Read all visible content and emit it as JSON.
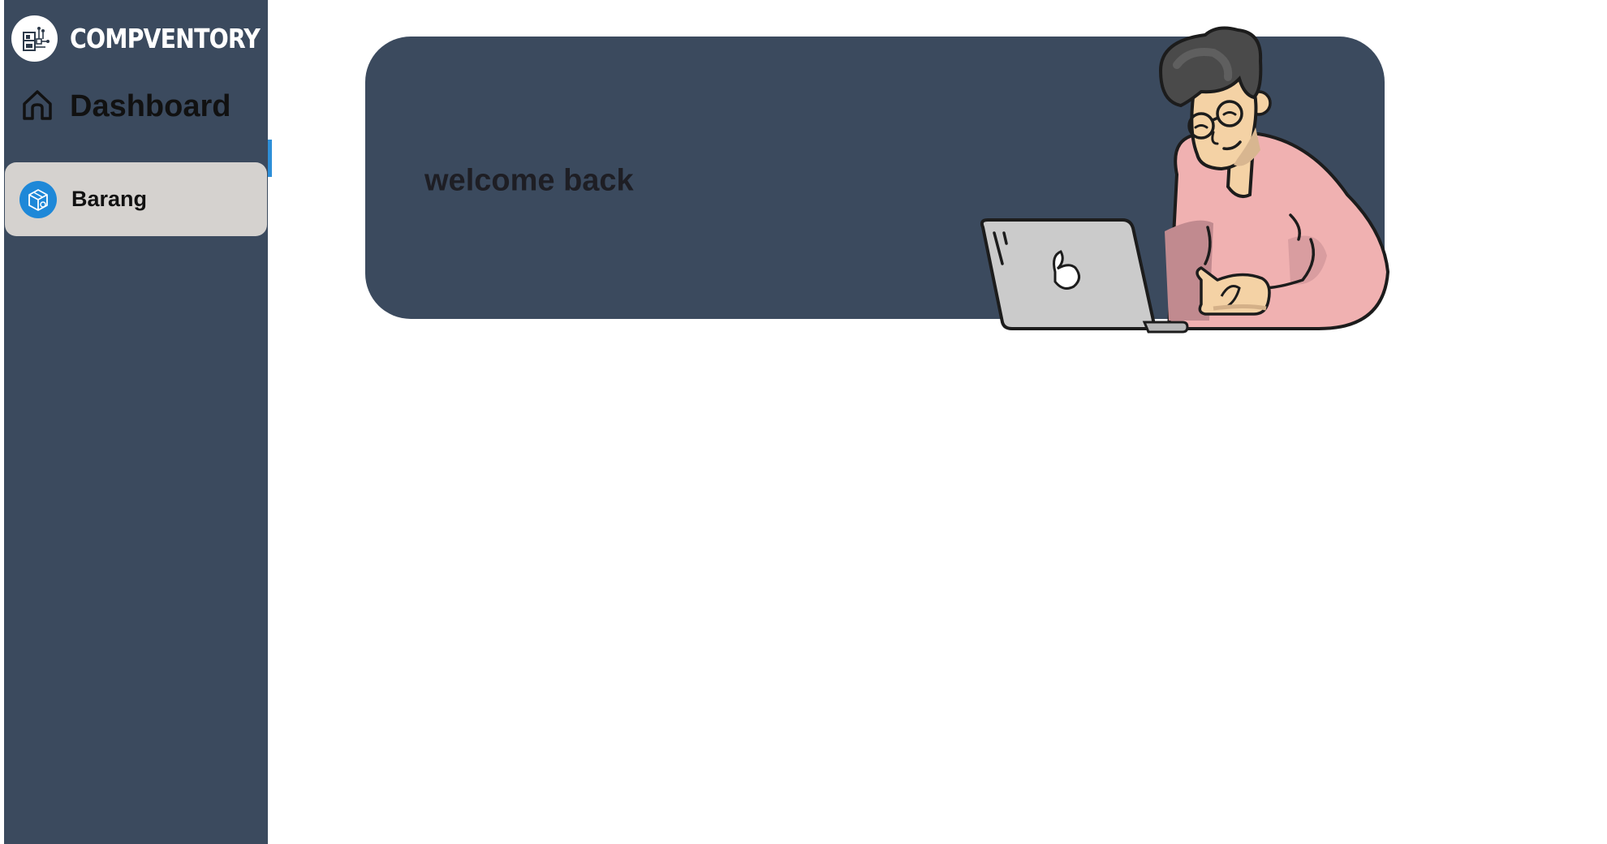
{
  "app": {
    "brand_name": "COMPVENTORY",
    "logo_icon": "inventory-logo-icon"
  },
  "sidebar": {
    "items": [
      {
        "label": "Dashboard",
        "icon": "home-icon",
        "active": false
      },
      {
        "label": "Barang",
        "icon": "box-icon",
        "active": true
      }
    ]
  },
  "main": {
    "welcome_text": "welcome back",
    "illustration": "person-with-laptop"
  },
  "colors": {
    "sidebar_bg": "#3b4a5e",
    "active_item_bg": "#d5d2cf",
    "accent": "#1e88d8",
    "card_bg": "#3b4a5e"
  }
}
